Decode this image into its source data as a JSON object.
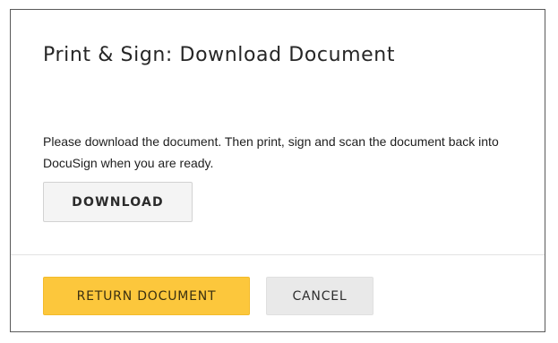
{
  "dialog": {
    "title": "Print & Sign: Download Document",
    "message": "Please download the document. Then print, sign and scan the document back into DocuSign when you are ready.",
    "download_label": "DOWNLOAD",
    "return_label": "RETURN DOCUMENT",
    "cancel_label": "CANCEL"
  },
  "colors": {
    "primary_button": "#fcc73c",
    "secondary_button": "#e9e9e9",
    "download_button": "#f4f4f4",
    "border": "#5a5a5a"
  }
}
